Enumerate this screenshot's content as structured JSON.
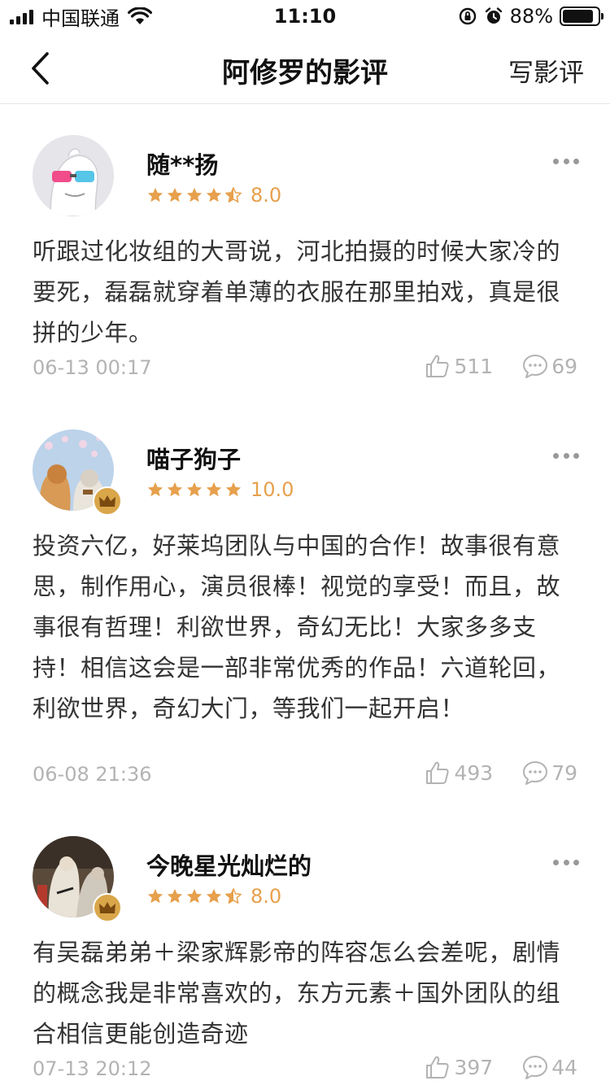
{
  "status_bar": {
    "carrier": "中国联通",
    "time": "11:10",
    "battery_percent": "88%",
    "battery_level": 0.88,
    "icons": [
      "signal-icon",
      "wifi-icon",
      "orientation-lock-icon",
      "alarm-icon",
      "battery-icon"
    ]
  },
  "nav": {
    "back_icon": "chevron-left-icon",
    "title": "阿修罗的影评",
    "write_label": "写影评"
  },
  "colors": {
    "star": "#e7a04d",
    "crown_badge": "#d9a64a",
    "meta_text": "#b3b3b3"
  },
  "reviews": [
    {
      "username": "随**扬",
      "stars": 4.5,
      "score": "8.0",
      "text": "听跟过化妆组的大哥说，河北拍摄的时候大家冷的要死，磊磊就穿着单薄的衣服在那里拍戏，真是很拼的少年。",
      "date": "06-13 00:17",
      "likes": "511",
      "comments": "69",
      "vip": false
    },
    {
      "username": "喵子狗子",
      "stars": 5,
      "score": "10.0",
      "text": "投资六亿，好莱坞团队与中国的合作！故事很有意思，制作用心，演员很棒！视觉的享受！而且，故事很有哲理！利欲世界，奇幻无比！大家多多支持！相信这会是一部非常优秀的作品！六道轮回，利欲世界，奇幻大门，等我们一起开启！",
      "date": "06-08 21:36",
      "likes": "493",
      "comments": "79",
      "vip": true
    },
    {
      "username": "今晚星光灿烂的",
      "stars": 4.5,
      "score": "8.0",
      "text": "有吴磊弟弟＋梁家辉影帝的阵容怎么会差呢，剧情的概念我是非常喜欢的，东方元素＋国外团队的组合相信更能创造奇迹",
      "date": "07-13 20:12",
      "likes": "397",
      "comments": "44",
      "vip": true
    }
  ]
}
